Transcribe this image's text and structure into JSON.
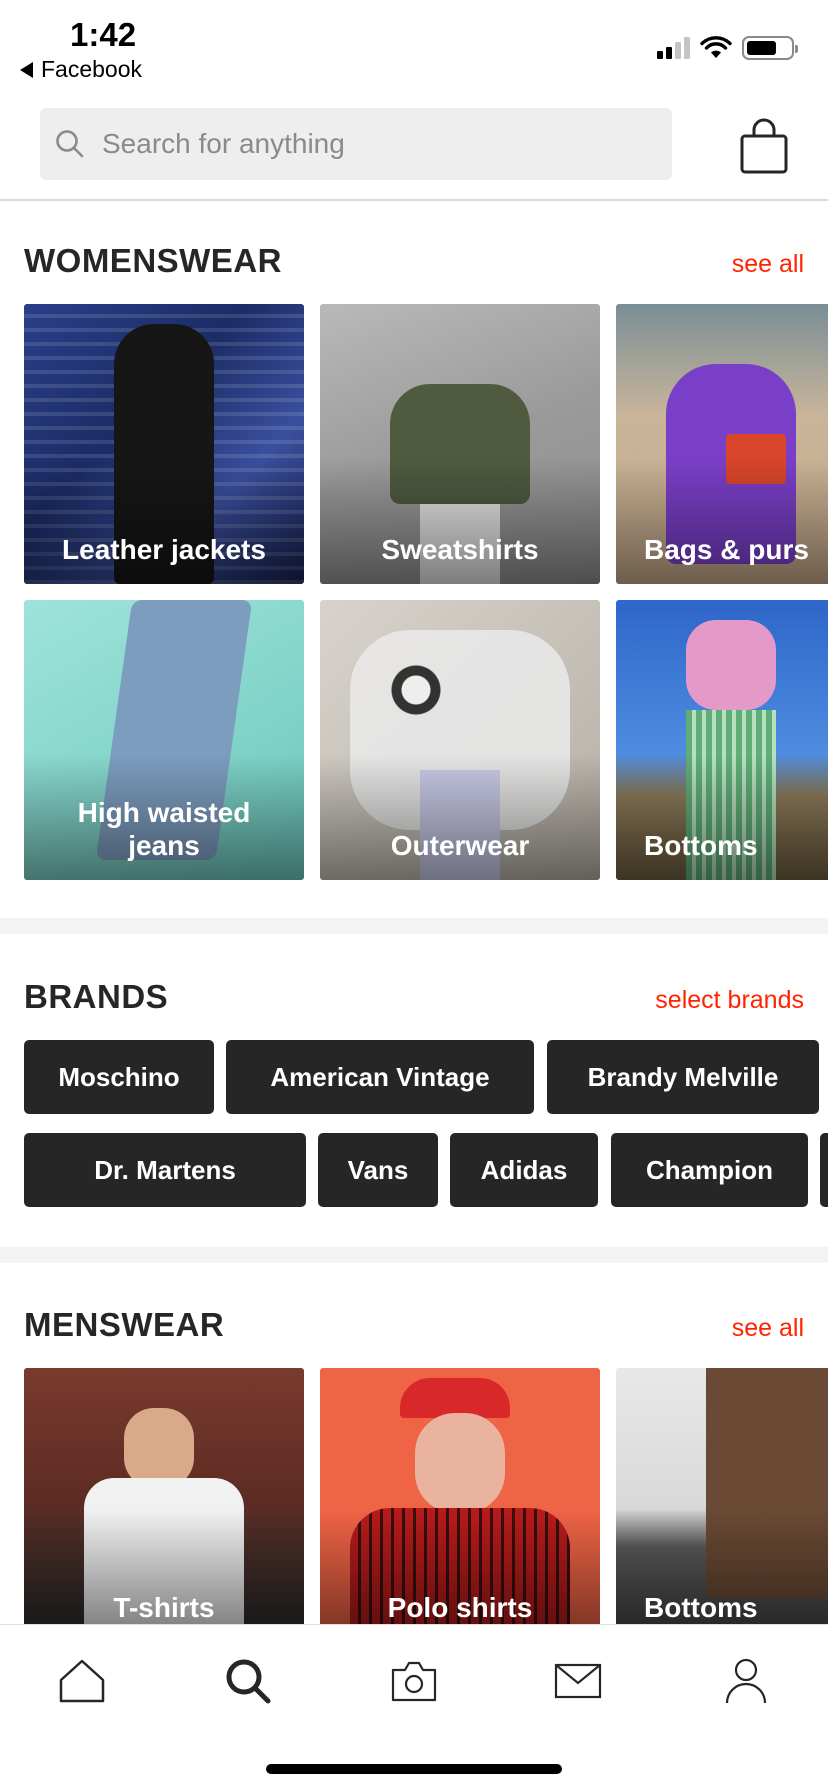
{
  "status_bar": {
    "time": "1:42",
    "back_app": "Facebook",
    "icons": [
      "cellular-signal-icon",
      "wifi-icon",
      "battery-icon"
    ]
  },
  "search": {
    "placeholder": "Search for anything",
    "icon": "search-icon",
    "bag_icon": "shopping-bag-icon"
  },
  "womenswear": {
    "title": "WOMENSWEAR",
    "link": "see all",
    "tiles": [
      {
        "label": "Leather jackets"
      },
      {
        "label": "Sweatshirts"
      },
      {
        "label": "Bags & purs"
      },
      {
        "label": "High waisted\njeans"
      },
      {
        "label": "Outerwear"
      },
      {
        "label": "Bottoms"
      }
    ]
  },
  "brands": {
    "title": "BRANDS",
    "link": "select brands",
    "row1": [
      "Moschino",
      "American Vintage",
      "Brandy Melville"
    ],
    "row2": [
      "Dr. Martens",
      "Vans",
      "Adidas",
      "Champion"
    ]
  },
  "menswear": {
    "title": "MENSWEAR",
    "link": "see all",
    "tiles": [
      {
        "label": "T-shirts"
      },
      {
        "label": "Polo shirts"
      },
      {
        "label": "Bottoms"
      }
    ]
  },
  "tab_bar": {
    "tabs": [
      "home-icon",
      "search-icon",
      "camera-icon",
      "mail-icon",
      "profile-icon"
    ],
    "active": "search-icon"
  },
  "colors": {
    "accent": "#ff2300",
    "chip_bg": "#262626",
    "search_bg": "#eeeeee"
  }
}
